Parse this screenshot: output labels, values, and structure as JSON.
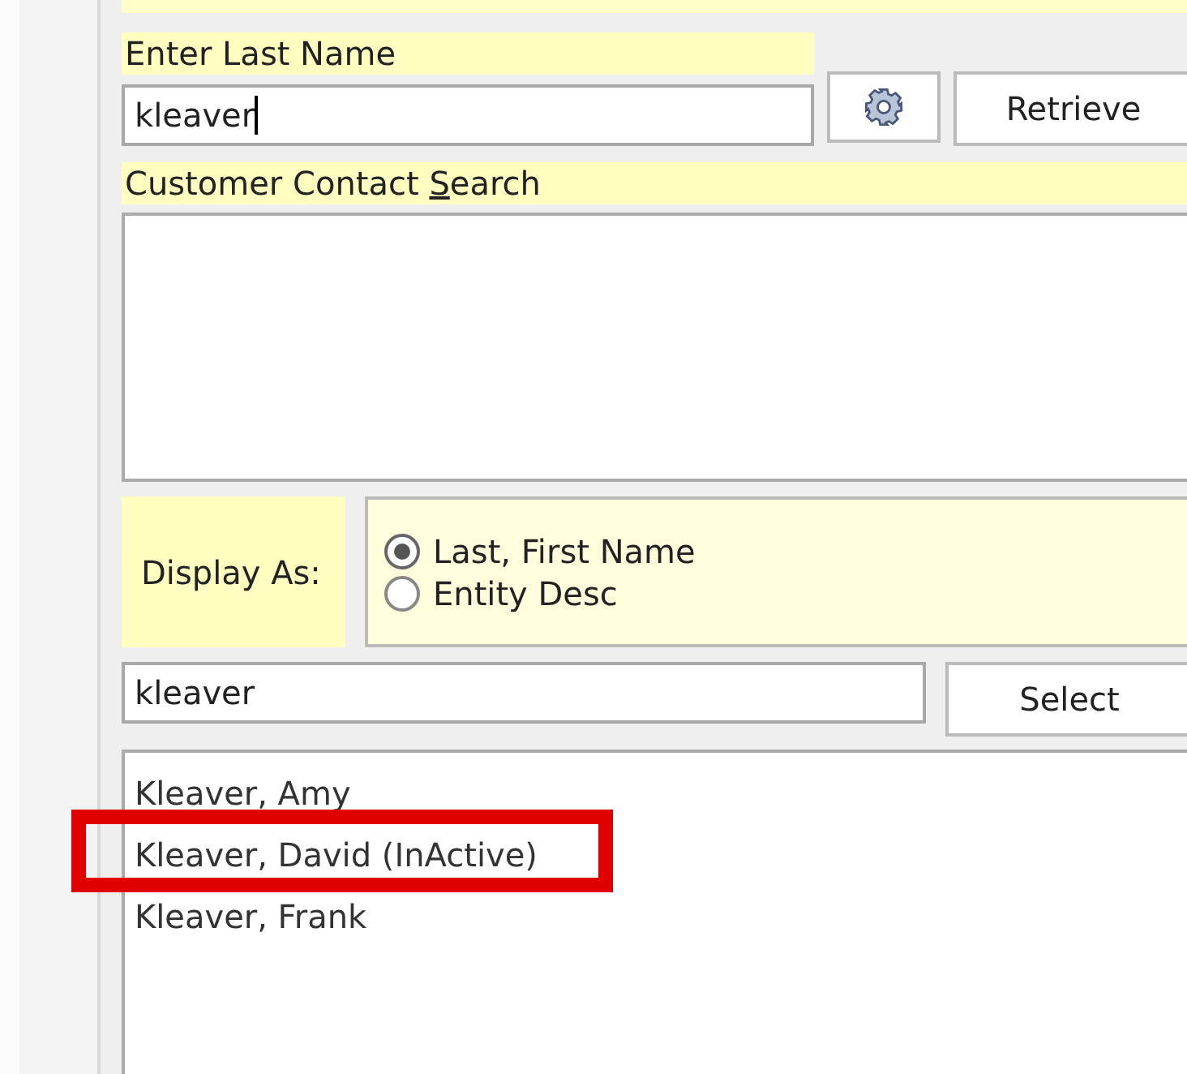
{
  "last_name": {
    "label": "Enter Last Name",
    "value": "kleaver",
    "focused": true
  },
  "settings_button": {
    "kind": "gear"
  },
  "retrieve_button": {
    "label": "Retrieve"
  },
  "contact_search": {
    "label_before": "Customer Contact ",
    "label_access_key": "S",
    "label_after": "earch"
  },
  "display_as": {
    "label": "Display As:",
    "options": [
      {
        "label": "Last, First Name",
        "selected": true
      },
      {
        "label": "Entity Desc",
        "selected": false
      }
    ]
  },
  "filter": {
    "value": "kleaver"
  },
  "select_button": {
    "label": "Select"
  },
  "results": [
    {
      "name": "Kleaver, Amy",
      "highlighted": false
    },
    {
      "name": "Kleaver, David (InActive)",
      "highlighted": true
    },
    {
      "name": "Kleaver, Frank",
      "highlighted": false
    }
  ]
}
